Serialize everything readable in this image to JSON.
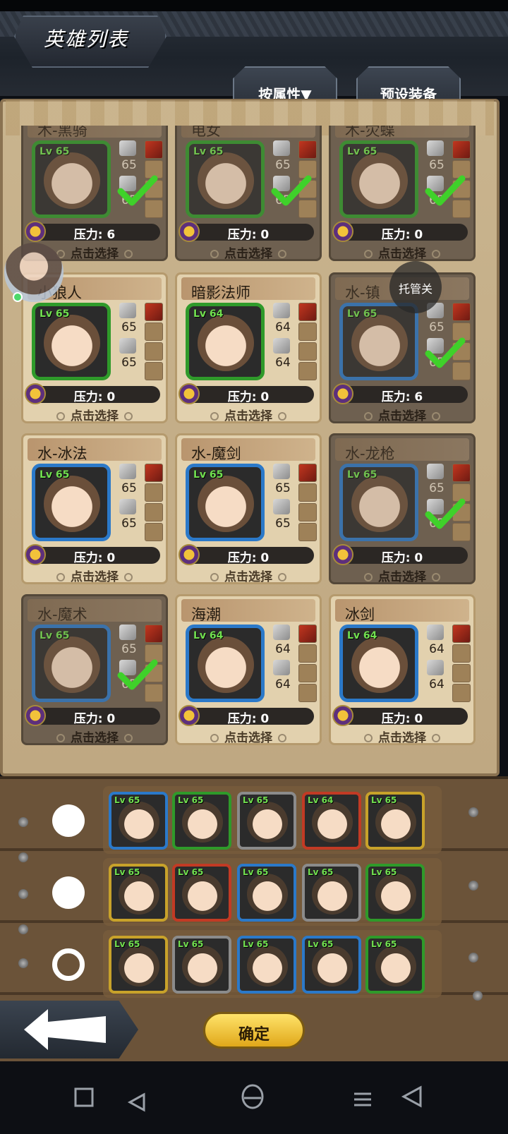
{
  "header": {
    "title": "英雄列表",
    "tab_attribute": "按属性▼",
    "tab_preset": "预设装备"
  },
  "floating": {
    "auto_label": "托管关"
  },
  "cards": [
    {
      "name": "木-黑骑",
      "level": "Lv 65",
      "atk": "65",
      "def": "65",
      "pressure": "压力: 6",
      "hint": "点击选择",
      "selected": true,
      "frame": "green"
    },
    {
      "name": "电女",
      "level": "Lv 65",
      "atk": "65",
      "def": "65",
      "pressure": "压力: 0",
      "hint": "点击选择",
      "selected": true,
      "frame": "green"
    },
    {
      "name": "木-灾蝶",
      "level": "Lv 65",
      "atk": "65",
      "def": "65",
      "pressure": "压力: 0",
      "hint": "点击选择",
      "selected": true,
      "frame": "green"
    },
    {
      "name": "小狼人",
      "level": "Lv 65",
      "atk": "65",
      "def": "65",
      "pressure": "压力: 0",
      "hint": "点击选择",
      "selected": false,
      "frame": "green"
    },
    {
      "name": "暗影法师",
      "level": "Lv 64",
      "atk": "64",
      "def": "64",
      "pressure": "压力: 0",
      "hint": "点击选择",
      "selected": false,
      "frame": "green"
    },
    {
      "name": "水-镇",
      "level": "Lv 65",
      "atk": "65",
      "def": "65",
      "pressure": "压力: 6",
      "hint": "点击选择",
      "selected": true,
      "frame": "blue"
    },
    {
      "name": "水-冰法",
      "level": "Lv 65",
      "atk": "65",
      "def": "65",
      "pressure": "压力: 0",
      "hint": "点击选择",
      "selected": false,
      "frame": "blue"
    },
    {
      "name": "水-魔剑",
      "level": "Lv 65",
      "atk": "65",
      "def": "65",
      "pressure": "压力: 0",
      "hint": "点击选择",
      "selected": false,
      "frame": "blue"
    },
    {
      "name": "水-龙枪",
      "level": "Lv 65",
      "atk": "65",
      "def": "65",
      "pressure": "压力: 0",
      "hint": "点击选择",
      "selected": true,
      "frame": "blue"
    },
    {
      "name": "水-魔术",
      "level": "Lv 65",
      "atk": "65",
      "def": "65",
      "pressure": "压力: 0",
      "hint": "点击选择",
      "selected": true,
      "frame": "blue"
    },
    {
      "name": "海潮",
      "level": "Lv 64",
      "atk": "64",
      "def": "64",
      "pressure": "压力: 0",
      "hint": "点击选择",
      "selected": false,
      "frame": "blue"
    },
    {
      "name": "冰剑",
      "level": "Lv 64",
      "atk": "64",
      "def": "64",
      "pressure": "压力: 0",
      "hint": "点击选择",
      "selected": false,
      "frame": "blue"
    }
  ],
  "teams": [
    {
      "radio": "filled",
      "members": [
        {
          "level": "Lv 65",
          "frame": "blue"
        },
        {
          "level": "Lv 65",
          "frame": "green"
        },
        {
          "level": "Lv 65",
          "frame": "gray"
        },
        {
          "level": "Lv 64",
          "frame": "red"
        },
        {
          "level": "Lv 65",
          "frame": "gold"
        }
      ]
    },
    {
      "radio": "filled",
      "members": [
        {
          "level": "Lv 65",
          "frame": "gold"
        },
        {
          "level": "Lv 65",
          "frame": "red"
        },
        {
          "level": "Lv 65",
          "frame": "blue"
        },
        {
          "level": "Lv 65",
          "frame": "gray"
        },
        {
          "level": "Lv 65",
          "frame": "green"
        }
      ]
    },
    {
      "radio": "ring",
      "members": [
        {
          "level": "Lv 65",
          "frame": "gold"
        },
        {
          "level": "Lv 65",
          "frame": "gray"
        },
        {
          "level": "Lv 65",
          "frame": "blue"
        },
        {
          "level": "Lv 65",
          "frame": "blue"
        },
        {
          "level": "Lv 65",
          "frame": "green"
        }
      ]
    }
  ],
  "footer": {
    "confirm_label": "确定"
  }
}
